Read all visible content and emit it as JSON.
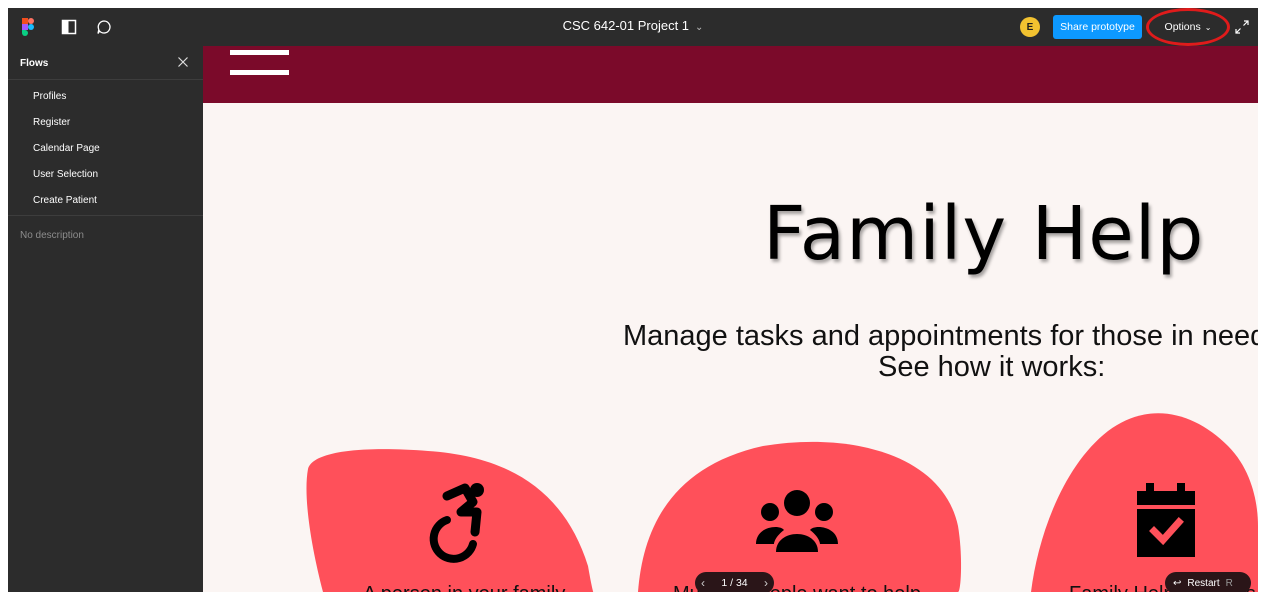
{
  "topbar": {
    "title": "CSC 642-01 Project 1",
    "avatar_initial": "E",
    "share_label": "Share prototype",
    "options_label": "Options"
  },
  "sidebar": {
    "title": "Flows",
    "items": [
      {
        "label": "Profiles"
      },
      {
        "label": "Register"
      },
      {
        "label": "Calendar Page"
      },
      {
        "label": "User Selection"
      },
      {
        "label": "Create Patient"
      }
    ],
    "description": "No description"
  },
  "canvas": {
    "title": "Family Help",
    "tagline": "Manage tasks and appointments for those in need",
    "subtag": "See how it works:",
    "cards": [
      {
        "text": "A person in your family",
        "icon": "wheelchair-icon"
      },
      {
        "text": "Multiple people want to help",
        "icon": "group-icon"
      },
      {
        "text": "Family Help provides a",
        "icon": "calendar-check-icon"
      }
    ]
  },
  "pager": {
    "current": "1",
    "total": "34",
    "label": "1 / 34"
  },
  "restart": {
    "label": "Restart",
    "key": "R"
  },
  "colors": {
    "toolbar": "#2c2c2c",
    "accent": "#0d99ff",
    "header_band": "#7b0a2a",
    "canvas_bg": "#fbf5f3",
    "blob": "#ff505a",
    "highlight": "#e01b1b"
  }
}
